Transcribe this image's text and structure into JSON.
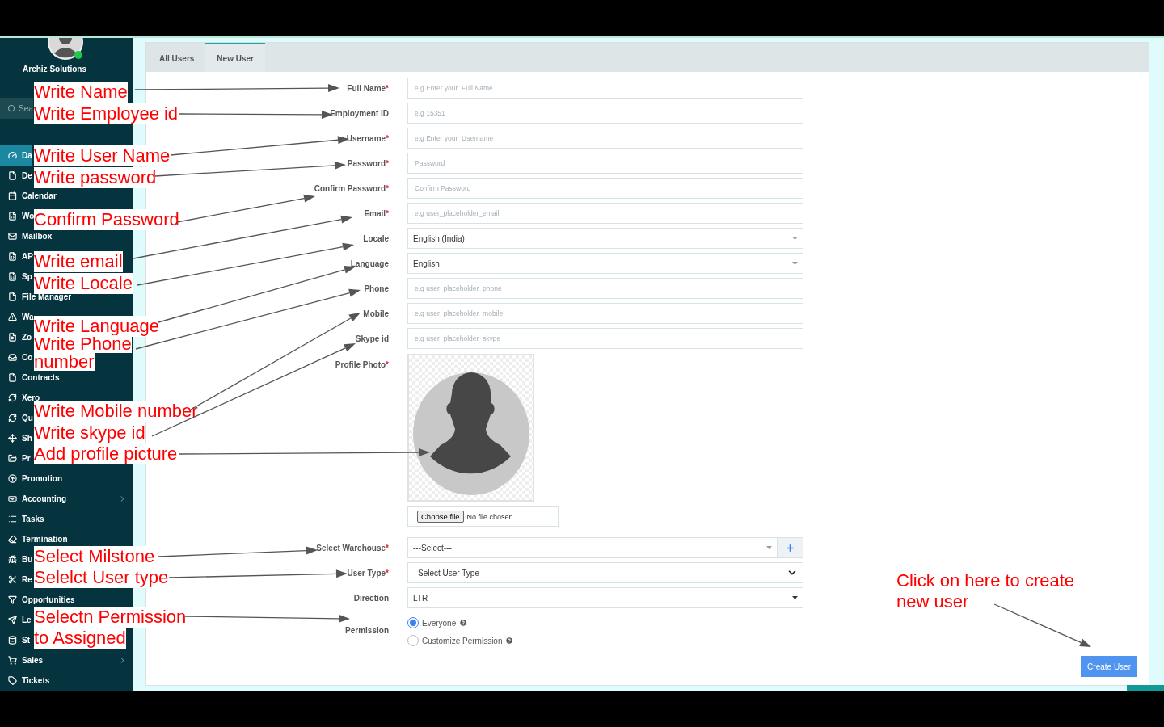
{
  "sidebar": {
    "company": "Archiz Solutions",
    "search": {
      "placeholder": "Sea"
    },
    "items": [
      {
        "label": "Da",
        "kind": "link",
        "selected": true
      },
      {
        "label": "De",
        "kind": "link",
        "selected": false
      },
      {
        "label": "Calendar",
        "kind": "link",
        "selected": false
      },
      {
        "label": "Wo",
        "kind": "link",
        "selected": false
      },
      {
        "label": "Mailbox",
        "kind": "link",
        "selected": false
      },
      {
        "label": "AP",
        "kind": "link",
        "selected": false
      },
      {
        "label": "Sp",
        "kind": "link",
        "selected": false
      },
      {
        "label": "File Manager",
        "kind": "link",
        "selected": false
      },
      {
        "label": "Wa",
        "kind": "link",
        "selected": false
      },
      {
        "label": "Zo",
        "kind": "link",
        "selected": false
      },
      {
        "label": "Co",
        "kind": "link",
        "selected": false
      },
      {
        "label": "Contracts",
        "kind": "link",
        "selected": false
      },
      {
        "label": "Xero",
        "kind": "link",
        "selected": false
      },
      {
        "label": "Qu",
        "kind": "link",
        "selected": false
      },
      {
        "label": "Sh",
        "kind": "link",
        "selected": false
      },
      {
        "label": "Pr",
        "kind": "link",
        "selected": false
      },
      {
        "label": "Promotion",
        "kind": "link",
        "selected": false
      },
      {
        "label": "Accounting",
        "kind": "menu",
        "selected": false
      },
      {
        "label": "Tasks",
        "kind": "link",
        "selected": false
      },
      {
        "label": "Termination",
        "kind": "link",
        "selected": false
      },
      {
        "label": "Bu",
        "kind": "link",
        "selected": false
      },
      {
        "label": "Re",
        "kind": "link",
        "selected": false
      },
      {
        "label": "Opportunities",
        "kind": "link",
        "selected": false
      },
      {
        "label": "Le",
        "kind": "link",
        "selected": false
      },
      {
        "label": "St",
        "kind": "link",
        "selected": false
      },
      {
        "label": "Sales",
        "kind": "menu",
        "selected": false
      },
      {
        "label": "Tickets",
        "kind": "link",
        "selected": false
      }
    ]
  },
  "tabs": [
    {
      "label": "All Users",
      "selected": false
    },
    {
      "label": "New User",
      "selected": true
    }
  ],
  "form": {
    "fields": [
      {
        "kind": "text",
        "label": "Full Name",
        "mark": "*",
        "placeholder": "e.g Enter your  Full Name"
      },
      {
        "kind": "text",
        "label": "Employment ID",
        "placeholder": "e.g 15351"
      },
      {
        "kind": "text",
        "label": "Username",
        "mark": "*",
        "placeholder": "e.g Enter your  Username"
      },
      {
        "kind": "text",
        "label": "Password",
        "mark": "*",
        "placeholder": "Password"
      },
      {
        "kind": "text",
        "label": "Confirm Password",
        "mark": "*",
        "placeholder": "Confirm Password"
      },
      {
        "kind": "text",
        "label": "Email",
        "mark": "*",
        "placeholder": "e.g user_placeholder_email"
      },
      {
        "kind": "select",
        "label": "Locale",
        "value": "English (India)"
      },
      {
        "kind": "select",
        "label": "Language",
        "value": "English"
      },
      {
        "kind": "text",
        "label": "Phone",
        "placeholder": "e.g user_placeholder_phone"
      },
      {
        "kind": "text",
        "label": "Mobile",
        "placeholder": "e.g user_placeholder_mobile"
      },
      {
        "kind": "text",
        "label": "Skype id",
        "placeholder": "e.g user_placeholder_skype"
      },
      {
        "kind": "photo",
        "label": "Profile Photo",
        "mark": "*",
        "button": "Choose file",
        "status": "No file chosen"
      },
      {
        "kind": "select_add",
        "label": "Select Warehouse",
        "mark": "*",
        "value": "---Select---"
      },
      {
        "kind": "native_select",
        "label": "User Type",
        "mark": "*",
        "value": "Select User Type"
      },
      {
        "kind": "select",
        "label": "Direction",
        "value": "LTR"
      },
      {
        "kind": "radio",
        "label": "Permission",
        "options": [
          {
            "label": "Everyone",
            "selected": true
          },
          {
            "label": "Customize Permission",
            "selected": false
          }
        ]
      }
    ],
    "submit": "Create User"
  },
  "annotations": [
    {
      "lines": [
        "Write  Name"
      ]
    },
    {
      "lines": [
        "Write Employee id"
      ]
    },
    {
      "lines": [
        "Write User Name"
      ]
    },
    {
      "lines": [
        "Write password"
      ]
    },
    {
      "lines": [
        "Confirm Password"
      ]
    },
    {
      "lines": [
        "Write email"
      ]
    },
    {
      "lines": [
        "Write Locale"
      ]
    },
    {
      "lines": [
        "Write Language"
      ]
    },
    {
      "lines": [
        "Write Phone",
        "number"
      ]
    },
    {
      "lines": [
        "Write Mobile number"
      ]
    },
    {
      "lines": [
        "Write skype id"
      ]
    },
    {
      "lines": [
        "Add profile picture"
      ]
    },
    {
      "lines": [
        "Select Milstone"
      ]
    },
    {
      "lines": [
        "Selelct User type"
      ]
    },
    {
      "lines": [
        "Selectn Permission",
        "to Assigned"
      ]
    },
    {
      "lines": [
        "Click on here to create",
        "new user"
      ]
    }
  ]
}
